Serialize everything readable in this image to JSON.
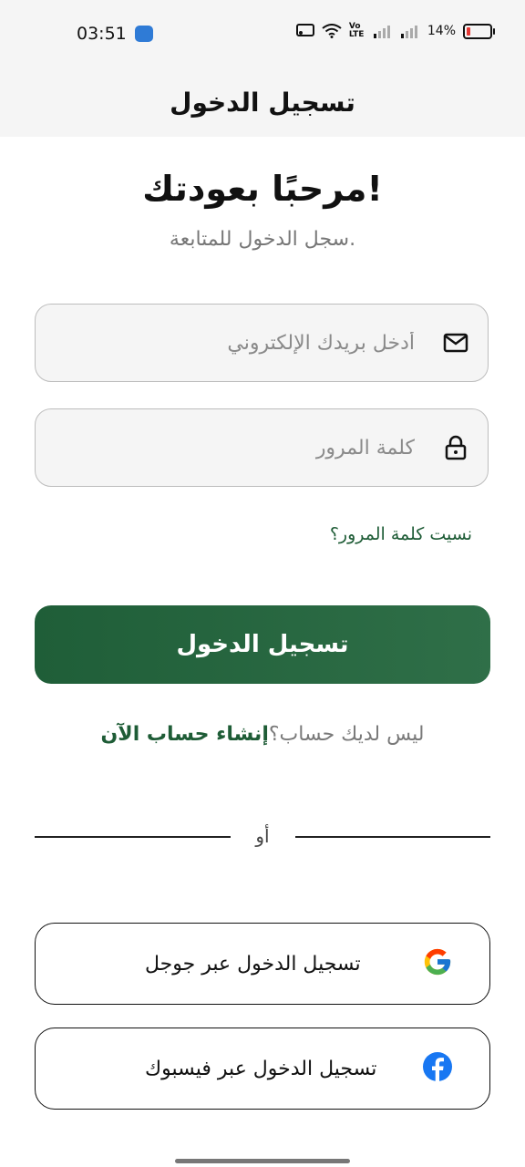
{
  "status_bar": {
    "time": "03:51",
    "network_label": "Vo LTE",
    "battery": "14%",
    "battery_level": 0.14,
    "battery_color": "#e53935"
  },
  "header": {
    "title": "تسجيل الدخول"
  },
  "welcome": {
    "title": "مرحبًا بعودتك!",
    "subtitle": "سجل الدخول للمتابعة."
  },
  "form": {
    "email_placeholder": "أدخل بريدك الإلكتروني",
    "email_value": "",
    "email_icon": "mail-icon",
    "password_placeholder": "كلمة المرور",
    "password_value": "",
    "password_icon": "lock-icon",
    "forgot_password": "نسيت كلمة المرور؟",
    "login_button": "تسجيل الدخول"
  },
  "signup": {
    "question": "ليس لديك حساب؟",
    "link": "إنشاء حساب الآن"
  },
  "divider": {
    "label": "أو"
  },
  "social": {
    "google_label": "تسجيل الدخول عبر جوجل",
    "google_icon": "google-icon",
    "facebook_label": "تسجيل الدخول عبر فيسبوك",
    "facebook_icon": "facebook-icon"
  },
  "colors": {
    "primary": "#1f5e38",
    "link": "#1e5c36",
    "facebook": "#1877f2"
  }
}
